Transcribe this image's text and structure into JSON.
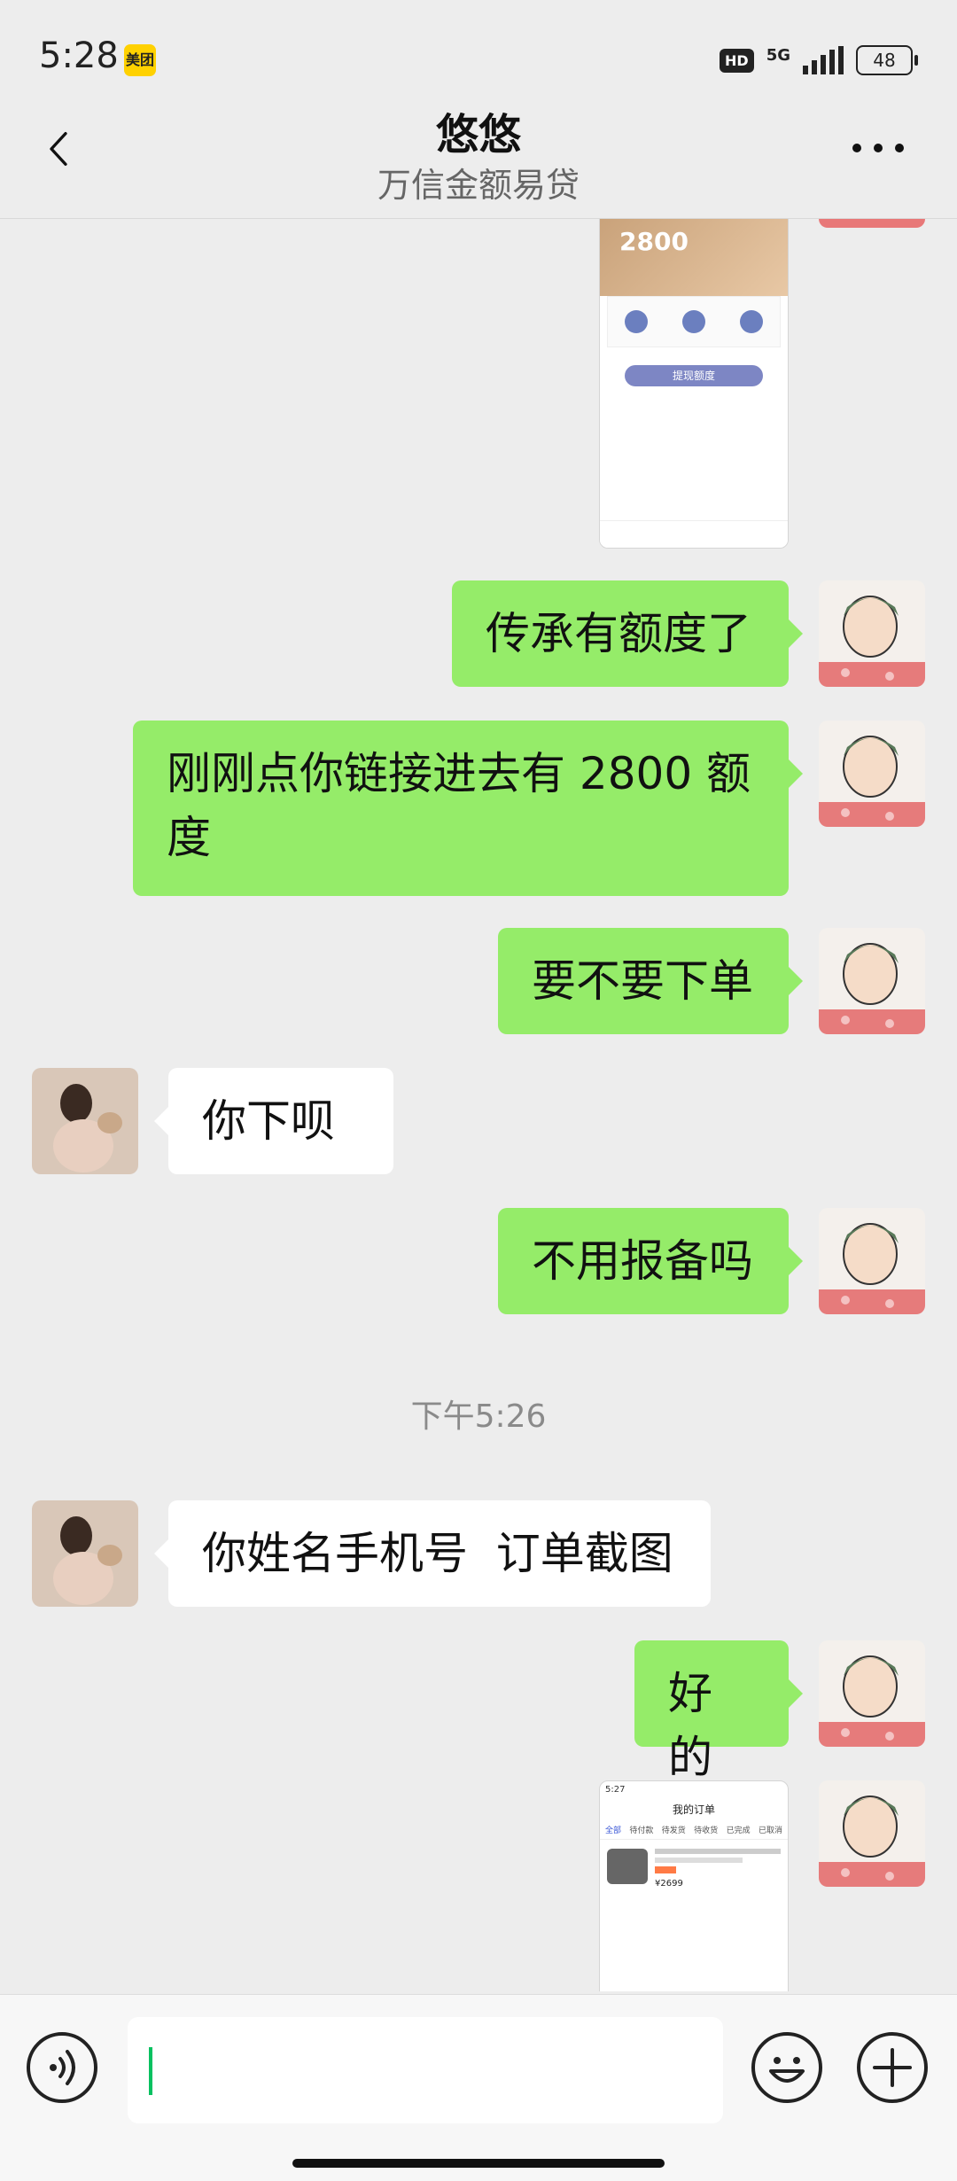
{
  "status_bar": {
    "time": "5:28",
    "app_badge": "美团",
    "hd": "HD",
    "network": "5G",
    "battery": "48"
  },
  "header": {
    "title": "悠悠",
    "subtitle": "万信金额易贷"
  },
  "messages": [
    {
      "side": "me",
      "text": "传承有额度了"
    },
    {
      "side": "me",
      "text": "刚刚点你链接进去有 2800 额度"
    },
    {
      "side": "me",
      "text": "要不要下单"
    },
    {
      "side": "other",
      "text": "你下呗"
    },
    {
      "side": "me",
      "text": "不用报备吗"
    },
    {
      "side": "other",
      "text": "你姓名手机号  订单截图"
    },
    {
      "side": "me",
      "text": "好的"
    }
  ],
  "timestamp": "下午5:26",
  "screenshot_top": {
    "amount": "2800",
    "button": "提现额度"
  },
  "screenshot_bottom": {
    "time": "5:27",
    "title": "我的订单",
    "tabs": [
      "全部",
      "待付款",
      "待发货",
      "待收货",
      "已完成",
      "已取消"
    ],
    "price": "¥2699"
  },
  "colors": {
    "me_bubble": "#95ec69",
    "other_bubble": "#ffffff",
    "background": "#ededed",
    "caret": "#07c160"
  }
}
